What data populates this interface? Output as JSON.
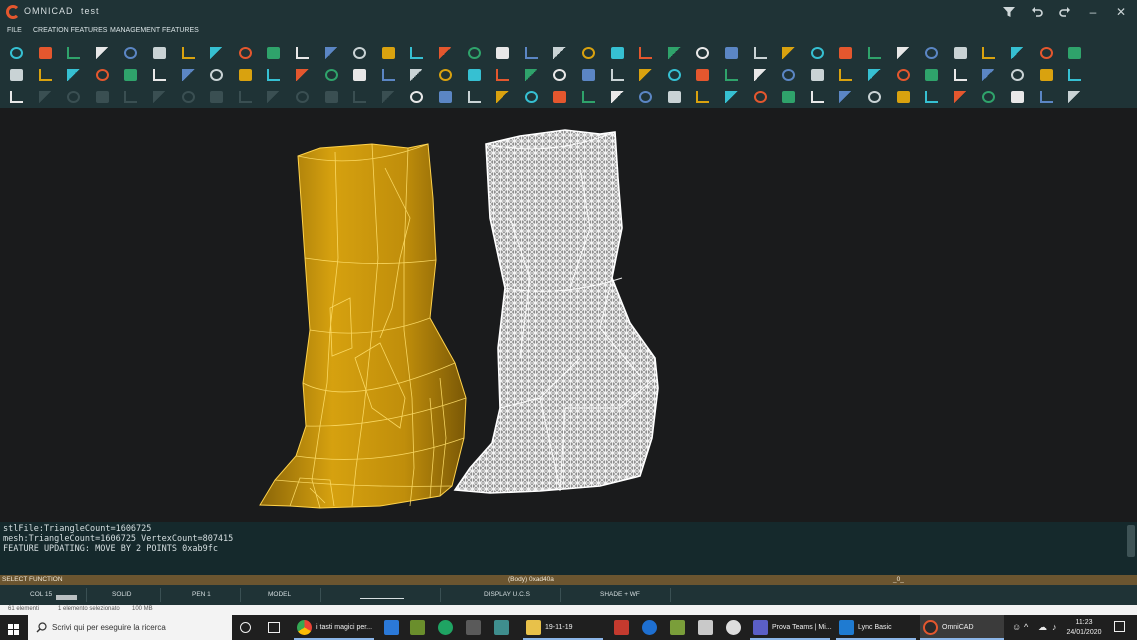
{
  "window": {
    "app_name": "OMNICAD",
    "document": "test"
  },
  "window_controls": [
    "filter-icon",
    "undo-icon",
    "redo-icon",
    "minimize-icon",
    "close-icon"
  ],
  "menu": {
    "items": [
      "FILE",
      "CREATION FEATURES",
      "MANAGEMENT FEATURES"
    ]
  },
  "console": {
    "lines": [
      "stlFile:TriangleCount=1606725",
      "mesh:TriangleCount=1606725 VertexCount=807415",
      "FEATURE UPDATING: MOVE BY 2 POINTS 0xab9fc"
    ]
  },
  "command_bar": {
    "left": "SELECT FUNCTION",
    "center": "(Body) 0xad40a",
    "right": "_0_"
  },
  "status_bar": {
    "col": "COL 15",
    "solid": "SOLID",
    "pen": "PEN 1",
    "model": "MODEL",
    "display": "DISPLAY U.C.S",
    "shade": "SHADE + WF"
  },
  "info_bar": {
    "elements": "61 elementi",
    "selected": "1 elemento selezionato",
    "size": "100 MB"
  },
  "taskbar": {
    "search_placeholder": "Scrivi qui per eseguire la ricerca",
    "apps": [
      {
        "label": "i tasti magici per..."
      },
      {
        "label": "19-11-19"
      },
      {
        "label": "Prova Teams | Mi..."
      },
      {
        "label": "Lync Basic"
      },
      {
        "label": "OmniCAD"
      }
    ],
    "clock": {
      "time": "11:23",
      "date": "24/01/2020"
    }
  },
  "colors": {
    "chrome": "#1f3336",
    "accent_cyan": "#36c0d2",
    "solid_yellow": "#d9a20f",
    "command_bar": "#6b5530"
  }
}
